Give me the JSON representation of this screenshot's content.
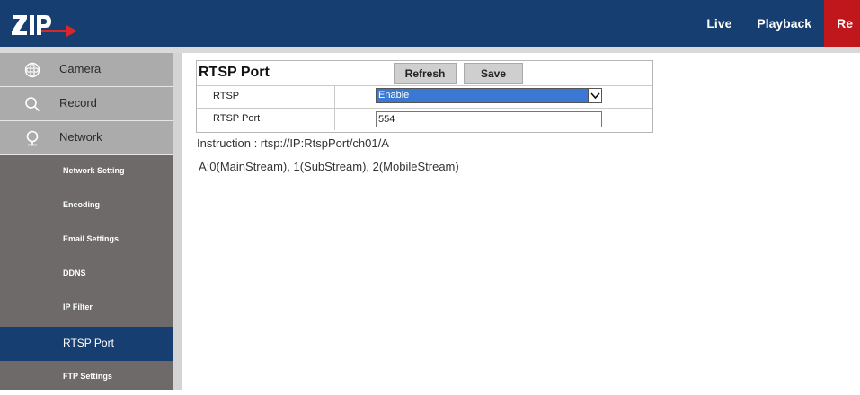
{
  "header": {
    "brand_color": "#173e70",
    "nav": [
      {
        "label": "Live",
        "active": false
      },
      {
        "label": "Playback",
        "active": false
      },
      {
        "label": "Re",
        "active": true,
        "color": "#c0171d"
      }
    ]
  },
  "sidebar": {
    "main_items": [
      {
        "label": "Camera",
        "icon": "camera-aperture-icon"
      },
      {
        "label": "Record",
        "icon": "search-icon"
      },
      {
        "label": "Network",
        "icon": "network-icon"
      }
    ],
    "sub_items": [
      {
        "label": "Network Setting",
        "active": false
      },
      {
        "label": "Encoding",
        "active": false
      },
      {
        "label": "Email Settings",
        "active": false
      },
      {
        "label": "DDNS",
        "active": false
      },
      {
        "label": "IP Filter",
        "active": false
      },
      {
        "label": "RTSP Port",
        "active": true
      },
      {
        "label": "FTP Settings",
        "active": false
      }
    ]
  },
  "panel": {
    "title": "RTSP Port",
    "refresh_label": "Refresh",
    "save_label": "Save",
    "rows": [
      {
        "label": "RTSP",
        "value": "Enable"
      },
      {
        "label": "RTSP Port",
        "value": "554"
      }
    ]
  },
  "instruction": "Instruction : rtsp://IP:RtspPort/ch01/A",
  "streams": "A:0(MainStream), 1(SubStream), 2(MobileStream)"
}
